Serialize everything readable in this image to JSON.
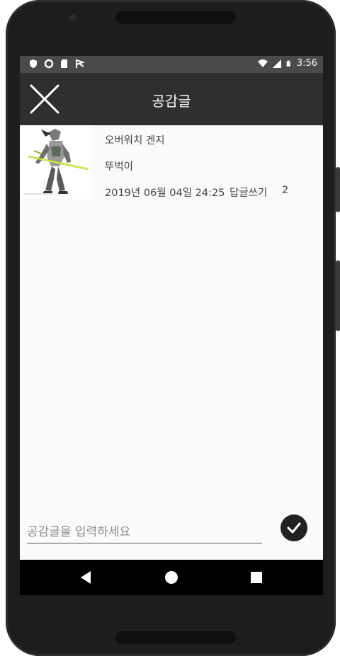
{
  "status_bar": {
    "time": "3:56",
    "left_icons": [
      "shield-icon",
      "circle-icon",
      "sd-card-icon",
      "flag-icon"
    ],
    "right_icons": [
      "wifi-icon",
      "signal-icon",
      "battery-icon"
    ]
  },
  "app_bar": {
    "title": "공감글",
    "close_icon": "close-icon"
  },
  "posts": [
    {
      "title": "오버워치 겐지",
      "author": "뚜벅이",
      "date": "2019년 06월 04일 24:25",
      "reply_label": "답글쓰기",
      "reply_count": "2"
    }
  ],
  "comment": {
    "placeholder": "공감글을 입력하세요",
    "value": "",
    "submit_icon": "check-icon"
  },
  "nav": {
    "buttons": [
      "back-icon",
      "home-icon",
      "recents-icon"
    ]
  },
  "colors": {
    "status_bar": "#4a4a4a",
    "app_bar": "#2f2f2f",
    "screen_bg": "#fafafa",
    "nav_bar": "#000000"
  }
}
